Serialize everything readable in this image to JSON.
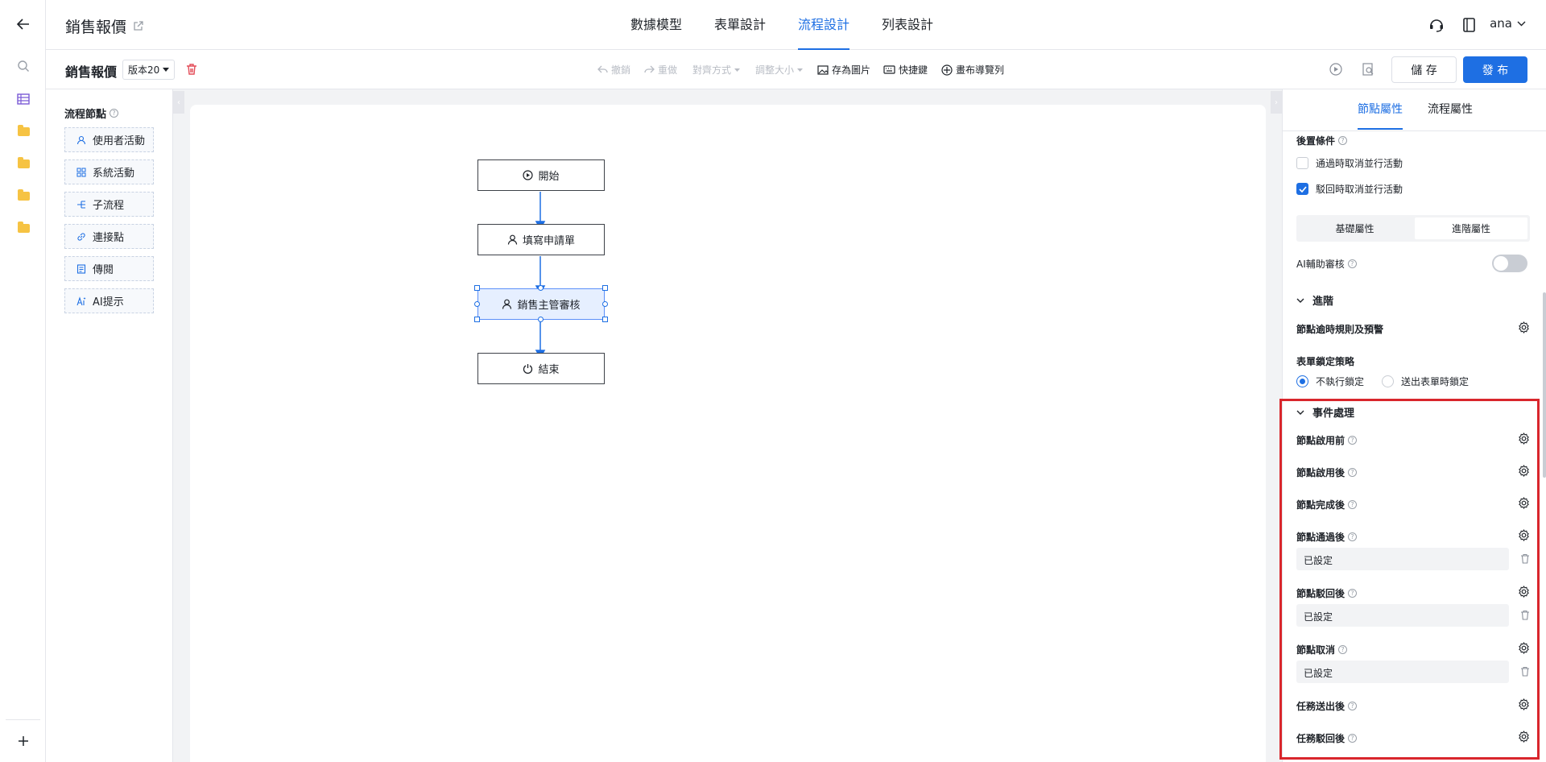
{
  "header": {
    "app_title": "銷售報價",
    "nav": [
      "數據模型",
      "表單設計",
      "流程設計",
      "列表設計"
    ],
    "active_nav": 2,
    "user": "ana"
  },
  "toolbar": {
    "process_name": "銷售報價",
    "version": "版本20",
    "undo": "撤銷",
    "redo": "重做",
    "align": "對齊方式",
    "resize": "調整大小",
    "save_image": "存為圖片",
    "shortcuts": "快捷鍵",
    "canvas_nav": "畫布導覽列",
    "save_btn": "儲 存",
    "publish_btn": "發 布"
  },
  "palette": {
    "title": "流程節點",
    "items": [
      {
        "label": "使用者活動",
        "icon": "user-icon"
      },
      {
        "label": "系統活動",
        "icon": "grid-icon"
      },
      {
        "label": "子流程",
        "icon": "subflow-icon"
      },
      {
        "label": "連接點",
        "icon": "link-icon"
      },
      {
        "label": "傳閱",
        "icon": "document-icon"
      },
      {
        "label": "AI提示",
        "icon": "ai-icon"
      }
    ]
  },
  "flow": {
    "nodes": [
      {
        "label": "開始",
        "icon": "play-icon"
      },
      {
        "label": "填寫申請單",
        "icon": "user-icon"
      },
      {
        "label": "銷售主管審核",
        "icon": "user-icon",
        "selected": true
      },
      {
        "label": "結束",
        "icon": "power-icon"
      }
    ]
  },
  "panel": {
    "tabs": [
      "節點屬性",
      "流程屬性"
    ],
    "active_tab": 0,
    "post_condition": "後置條件",
    "cancel_on_pass": {
      "label": "通過時取消並行活動",
      "checked": false
    },
    "cancel_on_reject": {
      "label": "駁回時取消並行活動",
      "checked": true
    },
    "subtabs": [
      "基礎屬性",
      "進階屬性"
    ],
    "active_subtab": 1,
    "ai_review": {
      "label": "AI輔助審核",
      "on": false
    },
    "advanced_section": "進階",
    "timeout_rule": "節點逾時規則及預警",
    "lock_strategy": "表單鎖定策略",
    "lock_options": [
      {
        "label": "不執行鎖定",
        "selected": true
      },
      {
        "label": "送出表單時鎖定",
        "selected": false
      }
    ],
    "event_section": "事件處理",
    "events": [
      {
        "label": "節點啟用前",
        "value": ""
      },
      {
        "label": "節點啟用後",
        "value": ""
      },
      {
        "label": "節點完成後",
        "value": ""
      },
      {
        "label": "節點通過後",
        "value": "已設定"
      },
      {
        "label": "節點駁回後",
        "value": "已設定"
      },
      {
        "label": "節點取消",
        "value": "已設定"
      },
      {
        "label": "任務送出後",
        "value": ""
      },
      {
        "label": "任務駁回後",
        "value": ""
      }
    ]
  },
  "colors": {
    "accent": "#1e6fe3",
    "highlight": "#d9262c",
    "danger": "#e34d59"
  }
}
